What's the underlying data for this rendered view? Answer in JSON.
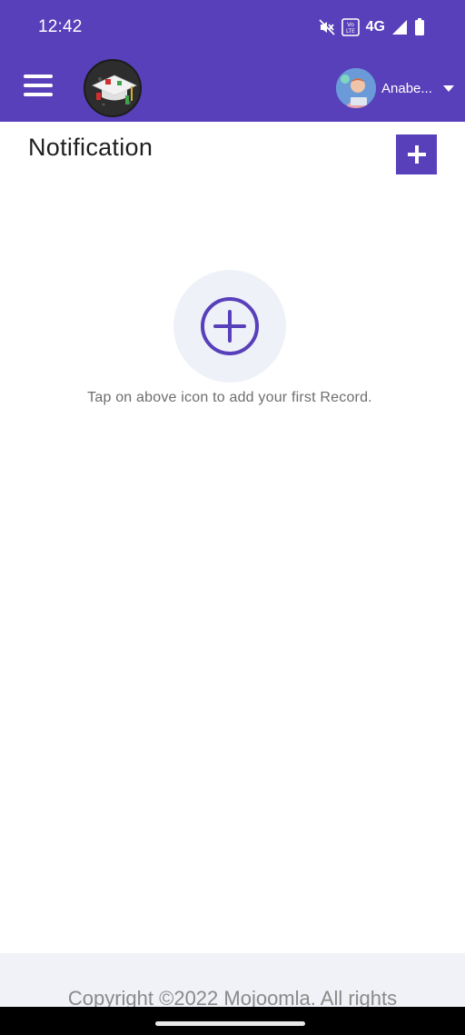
{
  "status_bar": {
    "time": "12:42",
    "network": "4G",
    "icons": [
      "mute-icon",
      "volte-icon",
      "signal-icon",
      "battery-icon"
    ]
  },
  "app_bar": {
    "user_name": "Anabe...",
    "menu_icon": "hamburger-menu-icon",
    "logo": "graduation-cap-logo"
  },
  "page": {
    "title": "Notification",
    "empty_message": "Tap on above icon to add your first Record."
  },
  "footer": {
    "copyright": "Copyright ©2022 Mojoomla. All rights"
  },
  "colors": {
    "primary": "#5840BA",
    "empty_circle_bg": "#eef1f8",
    "footer_bg": "#f0f2f7"
  }
}
